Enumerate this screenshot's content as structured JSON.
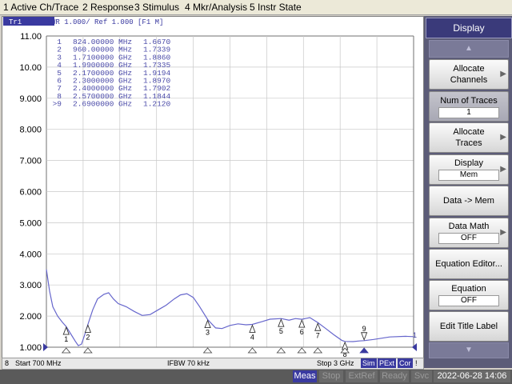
{
  "menu": {
    "items": [
      "1 Active Ch/Trace",
      "2 Response",
      "3 Stimulus",
      "4 Mkr/Analysis",
      "5 Instr State"
    ]
  },
  "trace": {
    "badge": "Tr1",
    "header": "S11  SWR 1.000/ Ref 1.000 [F1 M]",
    "color": "#6666cc"
  },
  "axis": {
    "y_ticks": [
      "11.00",
      "10.00",
      "9.000",
      "8.000",
      "7.000",
      "6.000",
      "5.000",
      "4.000",
      "3.000",
      "2.000",
      "1.000"
    ],
    "y_min": 1.0,
    "y_max": 11.0,
    "f_start_ghz": 0.7,
    "f_stop_ghz": 3.0,
    "divisions": 10
  },
  "markers": [
    {
      "id": "1",
      "freq": "824.00000 MHz",
      "value": "1.6670",
      "f": 0.824,
      "swr": 1.667,
      "active": false
    },
    {
      "id": "2",
      "freq": "960.00000 MHz",
      "value": "1.7339",
      "f": 0.96,
      "swr": 1.7339,
      "active": false
    },
    {
      "id": "3",
      "freq": "1.7100000 GHz",
      "value": "1.8860",
      "f": 1.71,
      "swr": 1.886,
      "active": false
    },
    {
      "id": "4",
      "freq": "1.9900000 GHz",
      "value": "1.7335",
      "f": 1.99,
      "swr": 1.7335,
      "active": false
    },
    {
      "id": "5",
      "freq": "2.1700000 GHz",
      "value": "1.9194",
      "f": 2.17,
      "swr": 1.9194,
      "active": false
    },
    {
      "id": "6",
      "freq": "2.3000000 GHz",
      "value": "1.8970",
      "f": 2.3,
      "swr": 1.897,
      "active": false
    },
    {
      "id": "7",
      "freq": "2.4000000 GHz",
      "value": "1.7902",
      "f": 2.4,
      "swr": 1.7902,
      "active": false
    },
    {
      "id": "8",
      "freq": "2.5700000 GHz",
      "value": "1.1844",
      "f": 2.57,
      "swr": 1.1844,
      "active": false
    },
    {
      "id": "9",
      "freq": "2.6900000 GHz",
      "value": "1.2120",
      "f": 2.69,
      "swr": 1.212,
      "active": true
    }
  ],
  "trace_points": [
    [
      0.7,
      3.5
    ],
    [
      0.72,
      2.8
    ],
    [
      0.74,
      2.3
    ],
    [
      0.77,
      2.0
    ],
    [
      0.8,
      1.8
    ],
    [
      0.824,
      1.667
    ],
    [
      0.85,
      1.45
    ],
    [
      0.88,
      1.2
    ],
    [
      0.9,
      1.05
    ],
    [
      0.92,
      1.1
    ],
    [
      0.94,
      1.4
    ],
    [
      0.96,
      1.7339
    ],
    [
      0.99,
      2.2
    ],
    [
      1.02,
      2.55
    ],
    [
      1.06,
      2.7
    ],
    [
      1.09,
      2.75
    ],
    [
      1.12,
      2.55
    ],
    [
      1.15,
      2.4
    ],
    [
      1.2,
      2.3
    ],
    [
      1.25,
      2.15
    ],
    [
      1.3,
      2.02
    ],
    [
      1.35,
      2.05
    ],
    [
      1.4,
      2.2
    ],
    [
      1.45,
      2.35
    ],
    [
      1.5,
      2.55
    ],
    [
      1.54,
      2.68
    ],
    [
      1.58,
      2.72
    ],
    [
      1.62,
      2.6
    ],
    [
      1.66,
      2.3
    ],
    [
      1.71,
      1.886
    ],
    [
      1.76,
      1.62
    ],
    [
      1.8,
      1.6
    ],
    [
      1.85,
      1.7
    ],
    [
      1.9,
      1.75
    ],
    [
      1.95,
      1.72
    ],
    [
      1.99,
      1.7335
    ],
    [
      2.05,
      1.82
    ],
    [
      2.1,
      1.9
    ],
    [
      2.17,
      1.9194
    ],
    [
      2.22,
      1.87
    ],
    [
      2.26,
      1.92
    ],
    [
      2.3,
      1.897
    ],
    [
      2.35,
      1.95
    ],
    [
      2.4,
      1.7902
    ],
    [
      2.45,
      1.6
    ],
    [
      2.5,
      1.4
    ],
    [
      2.55,
      1.22
    ],
    [
      2.57,
      1.1844
    ],
    [
      2.62,
      1.18
    ],
    [
      2.66,
      1.2
    ],
    [
      2.69,
      1.212
    ],
    [
      2.75,
      1.25
    ],
    [
      2.85,
      1.33
    ],
    [
      2.95,
      1.35
    ],
    [
      3.0,
      1.34
    ]
  ],
  "status": {
    "channel": "8",
    "start": "Start 700 MHz",
    "ifbw": "IFBW 70 kHz",
    "stop": "Stop 3 GHz",
    "sim": "Sim",
    "pext": "PExt",
    "cor": "Cor",
    "excl": "!"
  },
  "instrument": {
    "meas": "Meas",
    "stop": "Stop",
    "extref": "ExtRef",
    "ready": "Ready",
    "svc": "Svc",
    "datetime": "2022-06-28 14:06"
  },
  "softkeys": {
    "title": "Display",
    "allocate_channels": "Allocate Channels",
    "num_of_traces": {
      "label": "Num of Traces",
      "value": "1"
    },
    "allocate_traces": "Allocate Traces",
    "display": {
      "label": "Display",
      "value": "Mem"
    },
    "data_to_mem": "Data -> Mem",
    "data_math": {
      "label": "Data Math",
      "value": "OFF"
    },
    "equation_editor": "Equation Editor...",
    "equation": {
      "label": "Equation",
      "value": "OFF"
    },
    "edit_title_label": "Edit Title Label"
  }
}
